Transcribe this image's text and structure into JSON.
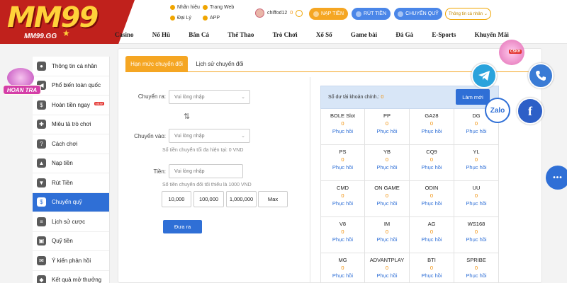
{
  "brand": {
    "logo": "MM99",
    "domain": "MM99.GG"
  },
  "quick_links": {
    "nhan_hieu": "Nhãn hiệu",
    "trang_web": "Trang Web",
    "dai_ly": "Đại Lý",
    "app": "APP"
  },
  "user": {
    "name": "chiffod12",
    "balance": "0"
  },
  "header_buttons": {
    "deposit": "NẠP TIỀN",
    "withdraw": "RÚT TIỀN",
    "transfer": "CHUYỂN QUỸ",
    "notice": "Thông tin cá nhân"
  },
  "nav": [
    "Casino",
    "Nổ Hũ",
    "Bắn Cá",
    "Thể Thao",
    "Trò Chơi",
    "Xổ Số",
    "Game bài",
    "Đá Gà",
    "E-Sports",
    "Khuyến Mãi"
  ],
  "promo_badge": "HOAN TRA",
  "sidebar": [
    {
      "label": "Thông tin cá nhân",
      "icon": "person-icon"
    },
    {
      "label": "Phổ biến toàn quốc",
      "icon": "megaphone-icon"
    },
    {
      "label": "Hoàn tiền ngay",
      "icon": "cashback-icon",
      "badge": "NEW"
    },
    {
      "label": "Miêu tả trò chơi",
      "icon": "gamepad-icon"
    },
    {
      "label": "Cách chơi",
      "icon": "help-icon"
    },
    {
      "label": "Nạp tiền",
      "icon": "deposit-icon"
    },
    {
      "label": "Rút Tiền",
      "icon": "withdraw-icon"
    },
    {
      "label": "Chuyển quỹ",
      "icon": "transfer-icon"
    },
    {
      "label": "Lịch sử cược",
      "icon": "history-icon"
    },
    {
      "label": "Quỹ tiền",
      "icon": "wallet-icon"
    },
    {
      "label": "Ý kiến phản hồi",
      "icon": "feedback-icon"
    },
    {
      "label": "Kết quả mở thưởng",
      "icon": "result-icon"
    }
  ],
  "tabs": {
    "limit": "Hạn mức chuyển đổi",
    "history": "Lịch sử chuyển đổi"
  },
  "form": {
    "from_label": "Chuyển ra:",
    "from_placeholder": "Vui lòng nhập",
    "to_label": "Chuyển vào:",
    "to_placeholder": "Vui lòng nhập",
    "max_hint": "Số tiền chuyển tối đa hiện tại: 0 VND",
    "amount_label": "Tiền:",
    "amount_placeholder": "Vui lòng nhập",
    "min_hint": "Số tiền chuyển đổi tối thiểu là 1000 VND",
    "amounts": [
      "10,000",
      "100,000",
      "1,000,000",
      "Max"
    ],
    "submit": "Đưa ra"
  },
  "balance": {
    "label": "Số dư tài khoản chính.: ",
    "value": "0",
    "refresh": "Làm mới"
  },
  "providers": [
    {
      "name": "BOLE Slot",
      "value": "0",
      "action": "Phục hồi"
    },
    {
      "name": "PP",
      "value": "0",
      "action": "Phục hồi"
    },
    {
      "name": "GA28",
      "value": "0",
      "action": "Phục hồi"
    },
    {
      "name": "DG",
      "value": "0",
      "action": "Phục hồi"
    },
    {
      "name": "PS",
      "value": "0",
      "action": "Phục hồi"
    },
    {
      "name": "YB",
      "value": "0",
      "action": "Phục hồi"
    },
    {
      "name": "CQ9",
      "value": "0",
      "action": "Phục hồi"
    },
    {
      "name": "YL",
      "value": "0",
      "action": "Phục hồi"
    },
    {
      "name": "CMD",
      "value": "0",
      "action": "Phục hồi"
    },
    {
      "name": "ON GAME",
      "value": "0",
      "action": "Phục hồi"
    },
    {
      "name": "ODIN",
      "value": "0",
      "action": "Phục hồi"
    },
    {
      "name": "UU",
      "value": "0",
      "action": "Phục hồi"
    },
    {
      "name": "V8",
      "value": "0",
      "action": "Phục hồi"
    },
    {
      "name": "IM",
      "value": "0",
      "action": "Phục hồi"
    },
    {
      "name": "AG",
      "value": "0",
      "action": "Phục hồi"
    },
    {
      "name": "WS168",
      "value": "0",
      "action": "Phục hồi"
    },
    {
      "name": "MG",
      "value": "0",
      "action": "Phục hồi"
    },
    {
      "name": "ADVANTPLAY",
      "value": "0",
      "action": "Phục hồi"
    },
    {
      "name": "BTI",
      "value": "0",
      "action": "Phục hồi"
    },
    {
      "name": "SPRIBE",
      "value": "0",
      "action": "Phục hồi"
    }
  ],
  "floating": {
    "cskh": "CSKH",
    "zalo": "Zalo",
    "facebook": "f",
    "chat": "•••"
  },
  "colors": {
    "accent": "#2f6fd6",
    "tab": "#f5a623",
    "brand": "#c0211c",
    "value": "#f08c00"
  }
}
